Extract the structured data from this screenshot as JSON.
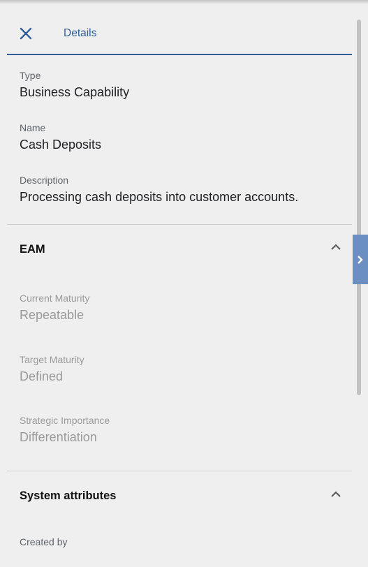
{
  "header": {
    "tab_label": "Details"
  },
  "details": {
    "type": {
      "label": "Type",
      "value": "Business Capability"
    },
    "name": {
      "label": "Name",
      "value": "Cash Deposits"
    },
    "description": {
      "label": "Description",
      "value": "Processing cash deposits into customer accounts."
    }
  },
  "eam": {
    "title": "EAM",
    "current_maturity": {
      "label": "Current Maturity",
      "value": "Repeatable"
    },
    "target_maturity": {
      "label": "Target Maturity",
      "value": "Defined"
    },
    "strategic_importance": {
      "label": "Strategic Importance",
      "value": "Differentiation"
    }
  },
  "system_attributes": {
    "title": "System attributes",
    "created_by": {
      "label": "Created by"
    }
  },
  "colors": {
    "accent": "#2f5e99",
    "side_toggle": "#6b8fc0",
    "muted_text": "#9a9a9a"
  }
}
